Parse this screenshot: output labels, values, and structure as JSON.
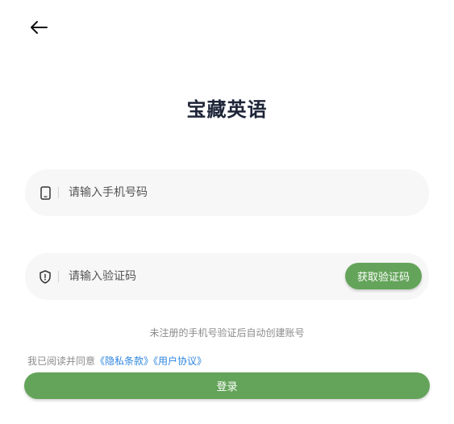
{
  "header": {
    "back_icon": "arrow-left-icon"
  },
  "title": "宝藏英语",
  "phone_field": {
    "icon": "phone-icon",
    "placeholder": "请输入手机号码",
    "value": ""
  },
  "code_field": {
    "icon": "shield-icon",
    "placeholder": "请输入验证码",
    "value": "",
    "get_code_label": "获取验证码"
  },
  "hint": "未注册的手机号验证后自动创建账号",
  "agreement": {
    "prefix": "我已阅读并同意",
    "privacy_link": "《隐私条款》",
    "user_link": "《用户协议》"
  },
  "login_label": "登录",
  "colors": {
    "accent": "#64a45a",
    "link": "#2e86de",
    "title": "#1e2538",
    "field_bg": "#f7f7f7"
  }
}
